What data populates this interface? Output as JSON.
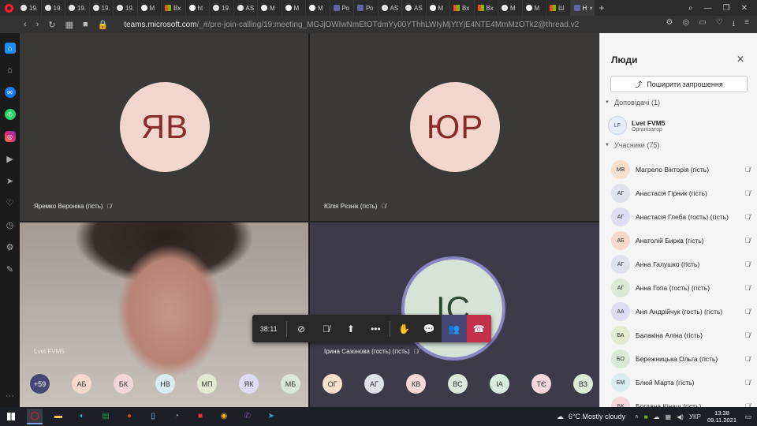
{
  "browser": {
    "tabs": [
      {
        "label": "19.",
        "icon": "globe",
        "active": false
      },
      {
        "label": "19.",
        "icon": "globe",
        "active": false
      },
      {
        "label": "19.",
        "icon": "globe",
        "active": false
      },
      {
        "label": "19.",
        "icon": "globe",
        "active": false
      },
      {
        "label": "19.",
        "icon": "globe",
        "active": false
      },
      {
        "label": "M",
        "icon": "wa",
        "active": false
      },
      {
        "label": "Вх",
        "icon": "ms",
        "active": false
      },
      {
        "label": "ht",
        "icon": "wa",
        "active": false
      },
      {
        "label": "19.",
        "icon": "globe",
        "active": false
      },
      {
        "label": "AS",
        "icon": "globe",
        "active": false
      },
      {
        "label": "M",
        "icon": "wa",
        "active": false
      },
      {
        "label": "M",
        "icon": "wa",
        "active": false
      },
      {
        "label": "M",
        "icon": "wa",
        "active": false
      },
      {
        "label": "Ро",
        "icon": "teams",
        "active": false
      },
      {
        "label": "Ро",
        "icon": "teams",
        "active": false
      },
      {
        "label": "AS",
        "icon": "globe",
        "active": false
      },
      {
        "label": "AS",
        "icon": "globe",
        "active": false
      },
      {
        "label": "M",
        "icon": "wa",
        "active": false
      },
      {
        "label": "Вх",
        "icon": "ms",
        "active": false
      },
      {
        "label": "Вх",
        "icon": "ms",
        "active": false
      },
      {
        "label": "M",
        "icon": "wa",
        "active": false
      },
      {
        "label": "M",
        "icon": "wa",
        "active": false
      },
      {
        "label": "Ш",
        "icon": "ms",
        "active": false
      },
      {
        "label": "Н",
        "icon": "teams",
        "active": true
      }
    ],
    "tab_close": "×",
    "new_tab": "+",
    "url_host": "teams.microsoft.com",
    "url_path": "/_#/pre-join-calling/19:meeting_MGJjOWIwNmEtOTdmYy00YThhLWIyMjYtYjE4NTE4MmMzOTk2@thread.v2"
  },
  "meeting": {
    "tiles": [
      {
        "initials": "ЯВ",
        "name": "Яремко Вероніка (гість)"
      },
      {
        "initials": "ЮР",
        "name": "Юлія Рєзнік (гість)"
      },
      {
        "initials": "",
        "name": "Lvet FVM5"
      },
      {
        "initials": "ІС",
        "name": "Ірина Сазонова (гость) (гість)"
      }
    ],
    "controls": {
      "timer": "38:11"
    },
    "strip": {
      "more": "+59",
      "chips": [
        {
          "initials": "АБ",
          "color": "#f6d9cc"
        },
        {
          "initials": "БК",
          "color": "#f3d6d9"
        },
        {
          "initials": "НВ",
          "color": "#d9ecef"
        },
        {
          "initials": "МП",
          "color": "#e3ead2"
        },
        {
          "initials": "ЯК",
          "color": "#dedcf2"
        },
        {
          "initials": "МБ",
          "color": "#dce8d6"
        },
        {
          "initials": "ОГ",
          "color": "#f7e0cc"
        },
        {
          "initials": "АГ",
          "color": "#dfe2ea"
        },
        {
          "initials": "КВ",
          "color": "#f5d8d8"
        },
        {
          "initials": "ВС",
          "color": "#dce8d9"
        },
        {
          "initials": "ІА",
          "color": "#d8ecdf"
        },
        {
          "initials": "ТЄ",
          "color": "#f5d8de"
        },
        {
          "initials": "ВЗ",
          "color": "#dbebd6"
        }
      ]
    }
  },
  "panel": {
    "title": "Люди",
    "share_label": "Поширити запрошення",
    "presenters_header": "Доповідачі (1)",
    "presenter": {
      "initials": "LF",
      "name": "Lvet FVM5",
      "role": "Організатор"
    },
    "attendees_header": "Учасники (75)",
    "attendees": [
      {
        "initials": "МВ",
        "name": "Магрело Вікторія (гість)",
        "color": "#f7e0cc"
      },
      {
        "initials": "АГ",
        "name": "Анастасія Гірник (гість)",
        "color": "#dfe2ea"
      },
      {
        "initials": "АГ",
        "name": "Анастасія Глеба (гость) (гість)",
        "color": "#dedcf2"
      },
      {
        "initials": "АБ",
        "name": "Анатолій Бирка (гість)",
        "color": "#f6d9cc"
      },
      {
        "initials": "АГ",
        "name": "Анна Галушко (гість)",
        "color": "#dfe2ea"
      },
      {
        "initials": "АГ",
        "name": "Анна Гопа (гость) (гість)",
        "color": "#dce8d6"
      },
      {
        "initials": "АА",
        "name": "Аня Андрійчук (гость) (гість)",
        "color": "#dedcf2"
      },
      {
        "initials": "БА",
        "name": "Балакіна Аліна (гість)",
        "color": "#e3ead2"
      },
      {
        "initials": "БО",
        "name": "Бережницька Ольга (гість)",
        "color": "#dce8d6"
      },
      {
        "initials": "БМ",
        "name": "Блюй Марта (гість)",
        "color": "#d9ecef"
      },
      {
        "initials": "БК",
        "name": "Богдана Кінащ (гість)",
        "color": "#f3d6d9"
      }
    ]
  },
  "taskbar": {
    "weather": "6°C  Mostly cloudy",
    "lang": "УКР",
    "time": "13:38",
    "date": "09.11.2021"
  }
}
